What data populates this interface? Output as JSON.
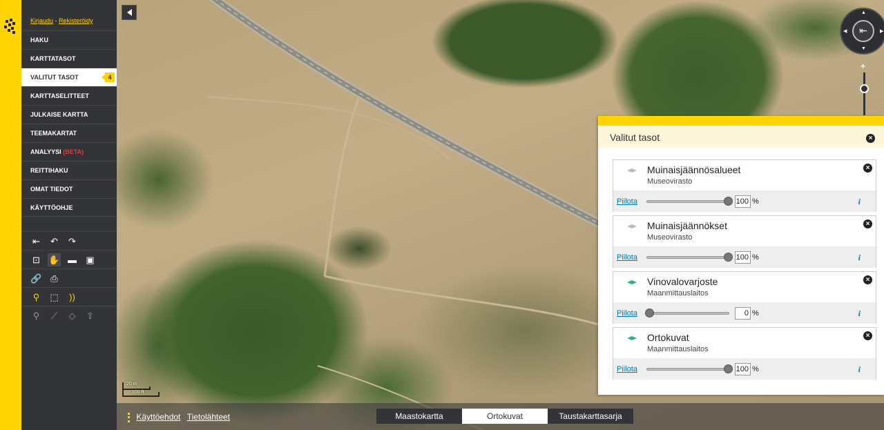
{
  "auth": {
    "login": "Kirjaudu",
    "separator": "-",
    "register": "Rekisteröidy"
  },
  "menu": [
    {
      "label": "HAKU",
      "active": false
    },
    {
      "label": "KARTTATASOT",
      "active": false
    },
    {
      "label": "VALITUT TASOT",
      "active": true,
      "badge": "4"
    },
    {
      "label": "KARTTASELITTEET",
      "active": false
    },
    {
      "label": "JULKAISE KARTTA",
      "active": false
    },
    {
      "label": "TEEMAKARTAT",
      "active": false
    },
    {
      "label": "ANALYYSI",
      "suffix": "(BETA)",
      "active": false
    },
    {
      "label": "REITTIHAKU",
      "active": false
    },
    {
      "label": "OMAT TIEDOT",
      "active": false
    },
    {
      "label": "KÄYTTÖOHJE",
      "active": false
    }
  ],
  "tools": {
    "row1": [
      "reset-view-icon",
      "undo-icon",
      "redo-icon"
    ],
    "row2": [
      "zoom-box-icon",
      "pan-hand-icon",
      "measure-line-icon",
      "measure-area-icon"
    ],
    "row3": [
      "link-icon",
      "print-icon"
    ],
    "row4": [
      "marker-icon",
      "select-area-icon",
      "feature-info-icon"
    ],
    "row5": [
      "add-point-icon",
      "add-line-icon",
      "add-area-icon",
      "import-icon"
    ]
  },
  "scale": {
    "top": "20 m",
    "bottom": "100 ft"
  },
  "bottom": {
    "terms": "Käyttöehdot",
    "sources": "Tietolähteet",
    "tabs": [
      {
        "label": "Maastokartta",
        "active": false
      },
      {
        "label": "Ortokuvat",
        "active": true
      },
      {
        "label": "Taustakarttasarja",
        "active": false
      }
    ]
  },
  "panel": {
    "title": "Valitut tasot",
    "hide_label": "Piilota",
    "percent": "%",
    "info": "i",
    "layers": [
      {
        "name": "Muinaisjäännösalueet",
        "source": "Museovirasto",
        "opacity": "100",
        "icon_color": "#bbbbbb"
      },
      {
        "name": "Muinaisjäännökset",
        "source": "Museovirasto",
        "opacity": "100",
        "icon_color": "#bbbbbb"
      },
      {
        "name": "Vinovalovarjoste",
        "source": "Maanmittauslaitos",
        "opacity": "0",
        "icon_color": "#2fae8a"
      },
      {
        "name": "Ortokuvat",
        "source": "Maanmittauslaitos",
        "opacity": "100",
        "icon_color": "#2fae8a"
      }
    ]
  },
  "colors": {
    "accent": "#ffd400",
    "sidebar": "#333438",
    "link": "#0077b3"
  }
}
